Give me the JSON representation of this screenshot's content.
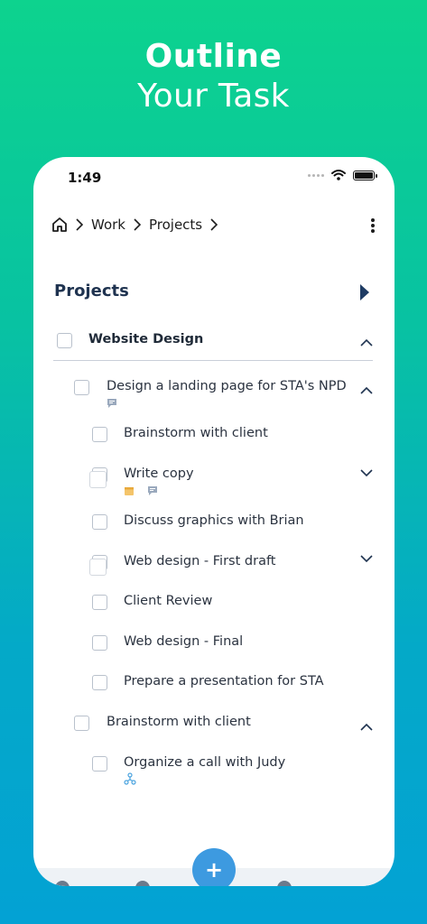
{
  "promo": {
    "line1": "Outline",
    "line2": "Your Task"
  },
  "status_bar": {
    "time": "1:49"
  },
  "breadcrumb": {
    "items": [
      "Work",
      "Projects"
    ]
  },
  "section": {
    "title": "Projects"
  },
  "tasks": [
    {
      "id": "website-design",
      "label": "Website Design"
    },
    {
      "id": "landing-page",
      "label": "Design a landing page for STA's NPD"
    },
    {
      "id": "brainstorm-client-1",
      "label": "Brainstorm with client"
    },
    {
      "id": "write-copy",
      "label": "Write copy"
    },
    {
      "id": "discuss-graphics",
      "label": "Discuss graphics with Brian"
    },
    {
      "id": "web-first-draft",
      "label": "Web design - First draft"
    },
    {
      "id": "client-review",
      "label": "Client Review"
    },
    {
      "id": "web-final",
      "label": "Web design - Final"
    },
    {
      "id": "prepare-presentation",
      "label": "Prepare a presentation for STA"
    },
    {
      "id": "brainstorm-client-2",
      "label": "Brainstorm with client"
    },
    {
      "id": "organize-call",
      "label": "Organize a call with Judy"
    }
  ],
  "fab": {
    "label": "+"
  },
  "colors": {
    "accent": "#3d9ae0",
    "title": "#1f3350",
    "note": "#9aa9bd",
    "due": "#f4c46a",
    "link": "#4aa3df"
  }
}
